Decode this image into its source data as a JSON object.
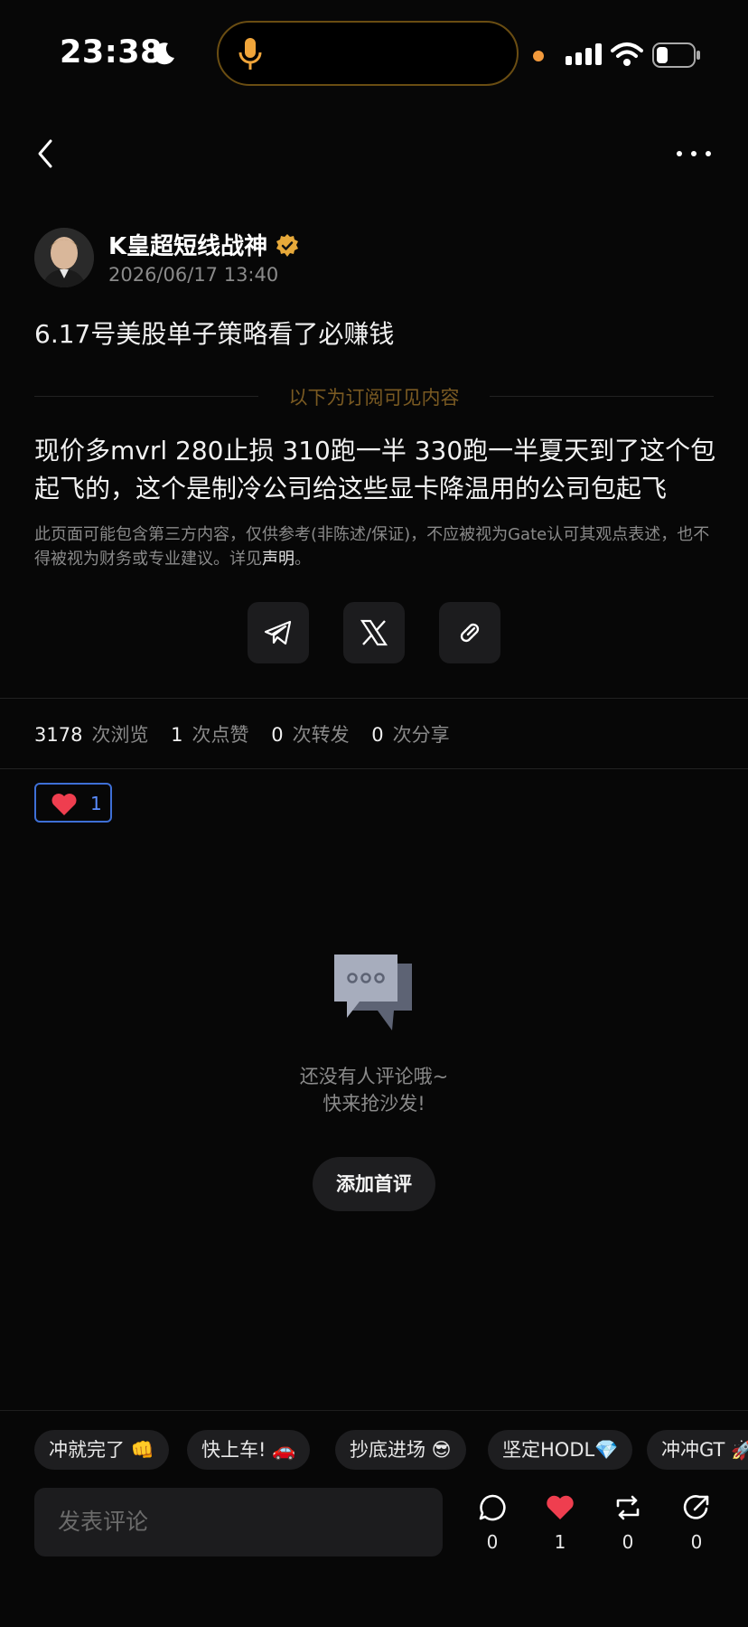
{
  "status_bar": {
    "time": "23:38"
  },
  "post": {
    "author": "K皇超短线战神",
    "date": "2026/06/17 13:40",
    "title": "6.17号美股单子策略看了必赚钱",
    "subscription_notice": "以下为订阅可见内容",
    "content": "现价多mvrl 280止损 310跑一半 330跑一半夏天到了这个包起飞的，这个是制冷公司给这些显卡降温用的公司包起飞",
    "disclaimer_text": "此页面可能包含第三方内容，仅供参考(非陈述/保证)，不应被视为Gate认可其观点表述，也不得被视为财务或专业建议。详见",
    "disclaimer_link": "声明",
    "disclaimer_end": "。"
  },
  "stats": {
    "views": "3178",
    "views_label": "次浏览",
    "likes": "1",
    "likes_label": "次点赞",
    "reposts": "0",
    "reposts_label": "次转发",
    "shares": "0",
    "shares_label": "次分享"
  },
  "reaction": {
    "count": "1"
  },
  "empty_comments": {
    "line1": "还没有人评论哦~",
    "line2": "快来抢沙发!",
    "button": "添加首评"
  },
  "quick_replies": [
    "冲就完了 👊",
    "快上车! 🚗",
    "抄底进场 😎",
    "坚定HODL💎",
    "冲冲GT 🚀"
  ],
  "bottom": {
    "placeholder": "发表评论",
    "comments": "0",
    "likes": "1",
    "reposts": "0",
    "shares": "0"
  },
  "colors": {
    "accent_blue": "#3e6fd6",
    "gold": "#7a5a22",
    "like_red": "#ef3e4f"
  }
}
